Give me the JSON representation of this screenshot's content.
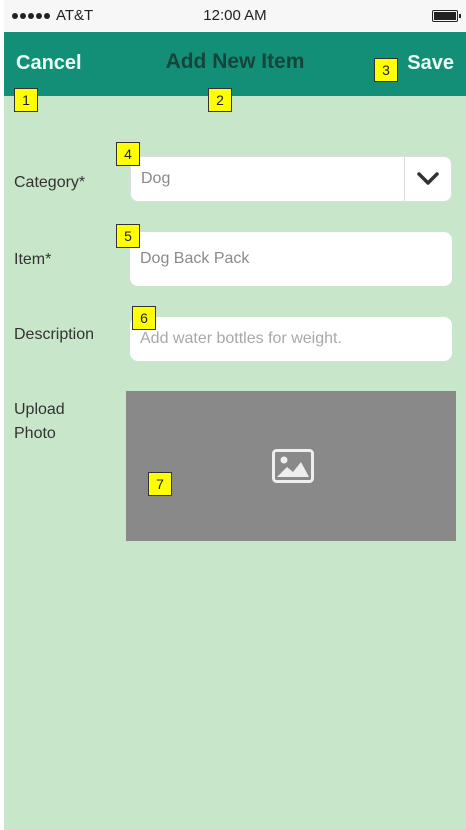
{
  "status_bar": {
    "carrier": "AT&T",
    "time": "12:00 AM"
  },
  "nav": {
    "cancel_label": "Cancel",
    "title": "Add New Item",
    "save_label": "Save",
    "bg_color": "#148f77"
  },
  "form": {
    "category": {
      "label": "Category*",
      "value": "Dog"
    },
    "item": {
      "label": "Item*",
      "value": "Dog Back Pack"
    },
    "description": {
      "label": "Description",
      "placeholder": "Add water bottles for weight."
    },
    "photo": {
      "label": "Upload Photo",
      "icon": "image-icon"
    }
  },
  "annotations": [
    "1",
    "2",
    "3",
    "4",
    "5",
    "6",
    "7"
  ],
  "colors": {
    "background": "#c8e6c9",
    "photo_placeholder": "#898989",
    "annotation": "#ffff00"
  }
}
